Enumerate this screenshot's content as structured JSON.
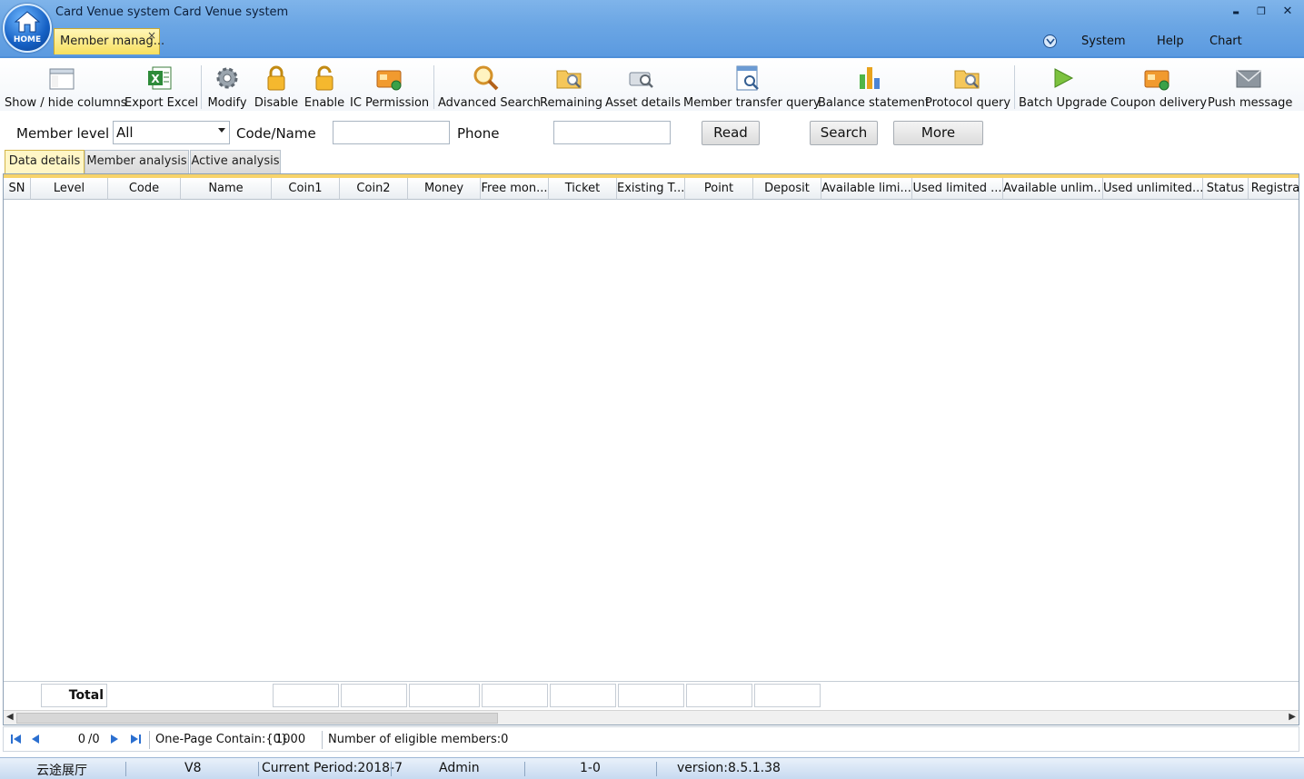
{
  "window": {
    "title": "Card Venue system Card Venue system",
    "home_label": "HOME",
    "controls": {
      "minimize": "▬",
      "restore": "❐",
      "close": "✕"
    }
  },
  "doc_tab": {
    "label": "Member manag...",
    "close": "×"
  },
  "top_menu": {
    "system": "System",
    "help": "Help",
    "chart": "Chart"
  },
  "toolbar": {
    "show_hide": "Show / hide columns",
    "export_excel": "Export Excel",
    "modify": "Modify",
    "disable": "Disable",
    "enable": "Enable",
    "ic_permission": "IC Permission",
    "advanced_search": "Advanced Search",
    "remaining": "Remaining",
    "asset_details": "Asset details",
    "member_transfer": "Member transfer query",
    "balance_statement": "Balance statement",
    "protocol_query": "Protocol query",
    "batch_upgrade": "Batch Upgrade",
    "coupon_delivery": "Coupon delivery",
    "push_message": "Push message"
  },
  "filter": {
    "member_level_label": "Member level",
    "member_level_value": "All",
    "code_name_label": "Code/Name",
    "code_name_value": "",
    "phone_label": "Phone",
    "phone_value": "",
    "read_btn": "Read",
    "search_btn": "Search",
    "more_btn": "More"
  },
  "subtabs": {
    "data_details": "Data details",
    "member_analysis": "Member analysis",
    "active_analysis": "Active analysis"
  },
  "columns": [
    "SN",
    "Level",
    "Code",
    "Name",
    "Coin1",
    "Coin2",
    "Money",
    "Free mon...",
    "Ticket",
    "Existing T...",
    "Point",
    "Deposit",
    "Available limi...",
    "Used limited ...",
    "Available unlim...",
    "Used unlimited...",
    "Status",
    "Registra"
  ],
  "total_label": "Total",
  "pager": {
    "page_value": "0",
    "page_total": "/0",
    "one_page": "One-Page Contain:{0}",
    "page_size": "1000",
    "eligible": "Number of eligible members:0"
  },
  "status": {
    "venue": "云途展厅",
    "version_code": "V8",
    "period": "Current Period:2018-7",
    "user": "Admin",
    "code": "1-0",
    "version": "version:8.5.1.38"
  },
  "colors": {
    "title_bar": "#6ba6e4",
    "active_tab": "#f7df5e",
    "grid_header_line": "#f7d36a"
  }
}
